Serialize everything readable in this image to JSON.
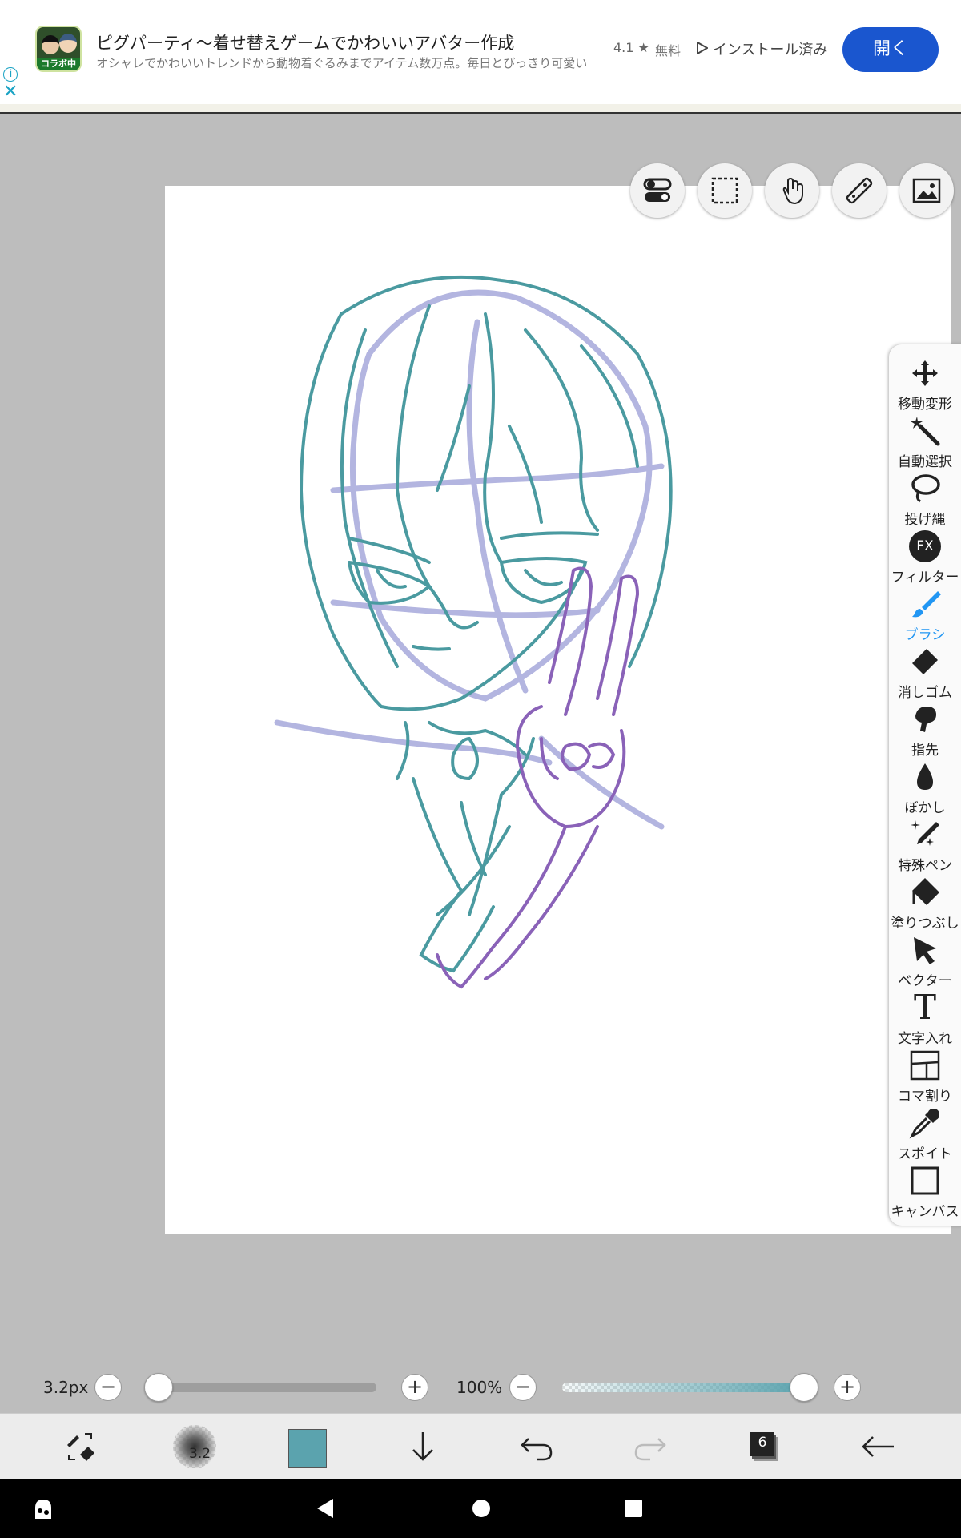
{
  "ad": {
    "icon_tag": "コラボ中",
    "title": "ピグパーティ〜着せ替えゲームでかわいいアバター作成",
    "description": "オシャレでかわいいトレンドから動物着ぐるみまでアイテム数万点。毎日とびっきり可愛い",
    "rating": "4.1 ★",
    "price": "無料",
    "installed": "インストール済み",
    "open_label": "開く",
    "info_glyph": "i",
    "close_glyph": "✕"
  },
  "top_tools": [
    {
      "name": "toggle-icon"
    },
    {
      "name": "selection-icon"
    },
    {
      "name": "hand-icon"
    },
    {
      "name": "ruler-icon"
    },
    {
      "name": "image-icon"
    }
  ],
  "tools": {
    "move": "移動変形",
    "auto_select": "自動選択",
    "lasso": "投げ縄",
    "filter": "フィルター",
    "filter_glyph": "FX",
    "brush": "ブラシ",
    "eraser": "消しゴム",
    "finger": "指先",
    "blur": "ぼかし",
    "special_pen": "特殊ペン",
    "fill": "塗りつぶし",
    "vector": "ベクター",
    "text": "文字入れ",
    "text_glyph": "T",
    "frame": "コマ割り",
    "eyedropper": "スポイト",
    "canvas": "キャンバス"
  },
  "sliders": {
    "size_label": "3.2px",
    "size_fraction": 0.0,
    "opacity_label": "100%",
    "opacity_fraction": 1.0,
    "minus": "−",
    "plus": "+"
  },
  "toolbar": {
    "brush_size": "3.2",
    "layer_count": "6",
    "current_color": "#5ba3ae"
  },
  "colors": {
    "accent": "#2196f3",
    "ad_button": "#1a56cf",
    "teal_stroke": "#4a9aa0",
    "purple_stroke": "#8a62b8",
    "guide_stroke": "#b3b5e0"
  }
}
